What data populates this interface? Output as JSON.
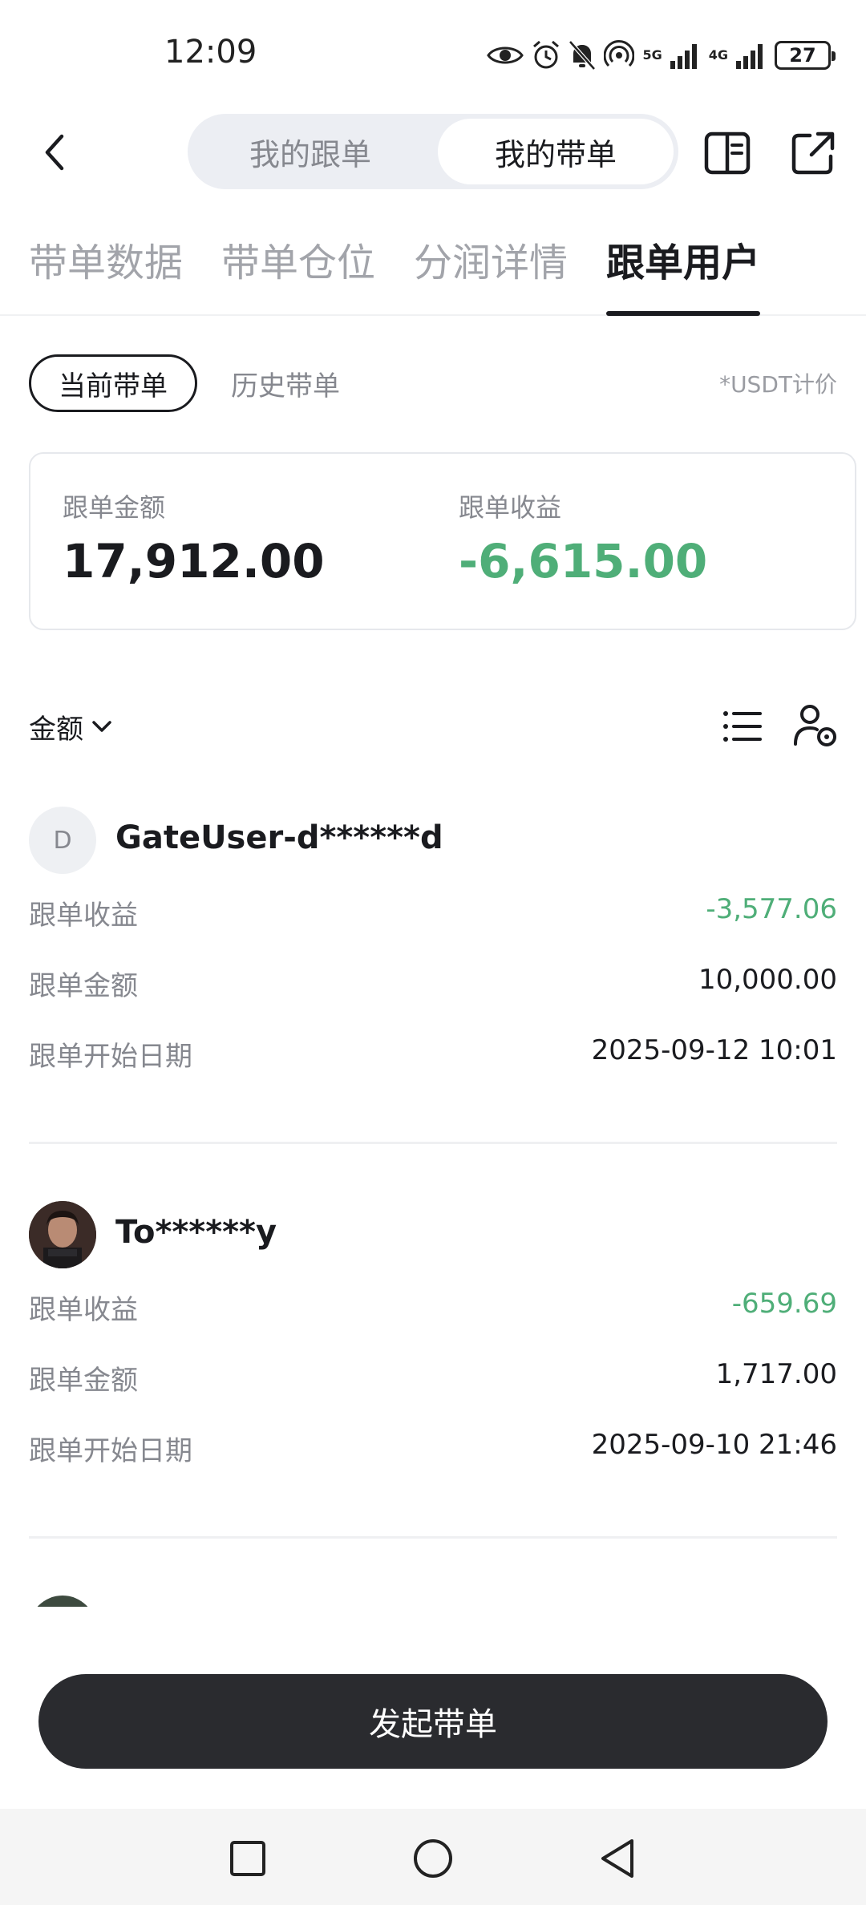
{
  "status_bar": {
    "time": "12:09",
    "signal_labels": [
      "5G",
      "4G"
    ],
    "sim_index": "1",
    "battery": "27"
  },
  "header": {
    "segments": [
      "我的跟单",
      "我的带单"
    ],
    "active_segment": "我的带单"
  },
  "tabs": [
    "带单数据",
    "带单仓位",
    "分润详情",
    "跟单用户"
  ],
  "active_tab": "跟单用户",
  "filters": {
    "current": "当前带单",
    "history": "历史带单",
    "note": "*USDT计价"
  },
  "summary": {
    "amount_label": "跟单金额",
    "amount_value": "17,912.00",
    "profit_label": "跟单收益",
    "profit_value": "-6,615.00"
  },
  "sort": {
    "label": "金额"
  },
  "followers": [
    {
      "avatar_initial": "D",
      "name": "GateUser-d******d",
      "rows": [
        {
          "label": "跟单收益",
          "value": "-3,577.06"
        },
        {
          "label": "跟单金额",
          "value": "10,000.00"
        },
        {
          "label": "跟单开始日期",
          "value": "2025-09-12 10:01"
        }
      ]
    },
    {
      "avatar_initial": "",
      "name": "To******y",
      "rows": [
        {
          "label": "跟单收益",
          "value": "-659.69"
        },
        {
          "label": "跟单金额",
          "value": "1,717.00"
        },
        {
          "label": "跟单开始日期",
          "value": "2025-09-10 21:46"
        }
      ]
    }
  ],
  "bottom_button": "发起带单",
  "colors": {
    "accent_dark": "#2a2b2f",
    "profit_negative": "#4fae78",
    "muted_text": "#86888f"
  },
  "icons": [
    "back-arrow-icon",
    "book-icon",
    "share-icon",
    "list-icon",
    "user-settings-icon",
    "chevron-down-icon",
    "square-icon",
    "circle-icon",
    "triangle-back-icon"
  ]
}
